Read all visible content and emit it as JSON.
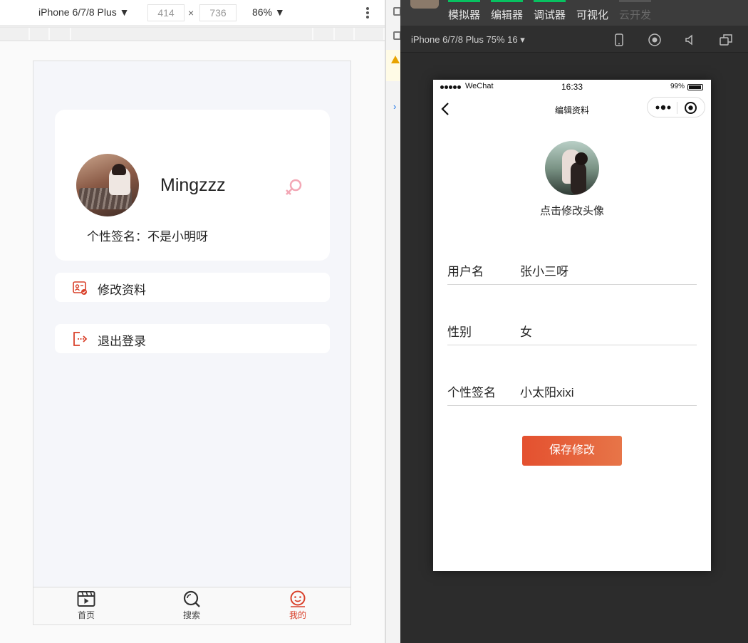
{
  "devtools": {
    "device": "iPhone 6/7/8 Plus ▼",
    "width": "414",
    "times": "×",
    "height": "736",
    "zoom": "86% ▼"
  },
  "app_left": {
    "username": "Mingzzz",
    "signature": "个性签名：不是小明呀",
    "menu": [
      {
        "label": "修改资料",
        "icon": "edit-profile-icon"
      },
      {
        "label": "退出登录",
        "icon": "logout-icon"
      }
    ],
    "tabs": [
      {
        "label": "首页",
        "icon": "home-video-icon"
      },
      {
        "label": "搜索",
        "icon": "search-icon"
      },
      {
        "label": "我的",
        "icon": "smiley-user-icon"
      }
    ],
    "accent": "#d9402a"
  },
  "wx_devtools": {
    "tabs": [
      "模拟器",
      "编辑器",
      "调试器",
      "可视化",
      "云开发"
    ],
    "device_label": "iPhone 6/7/8 Plus 75% 16 ▾"
  },
  "app_right": {
    "status": {
      "carrier": "WeChat",
      "time": "16:33",
      "battery": "99%"
    },
    "nav_title": "编辑资料",
    "change_avatar": "点击修改头像",
    "fields": [
      {
        "label": "用户名",
        "value": "张小三呀"
      },
      {
        "label": "性别",
        "value": "女"
      },
      {
        "label": "个性签名",
        "value": "小太阳xixi"
      }
    ],
    "save_label": "保存修改",
    "save_color": "#e4502f"
  }
}
